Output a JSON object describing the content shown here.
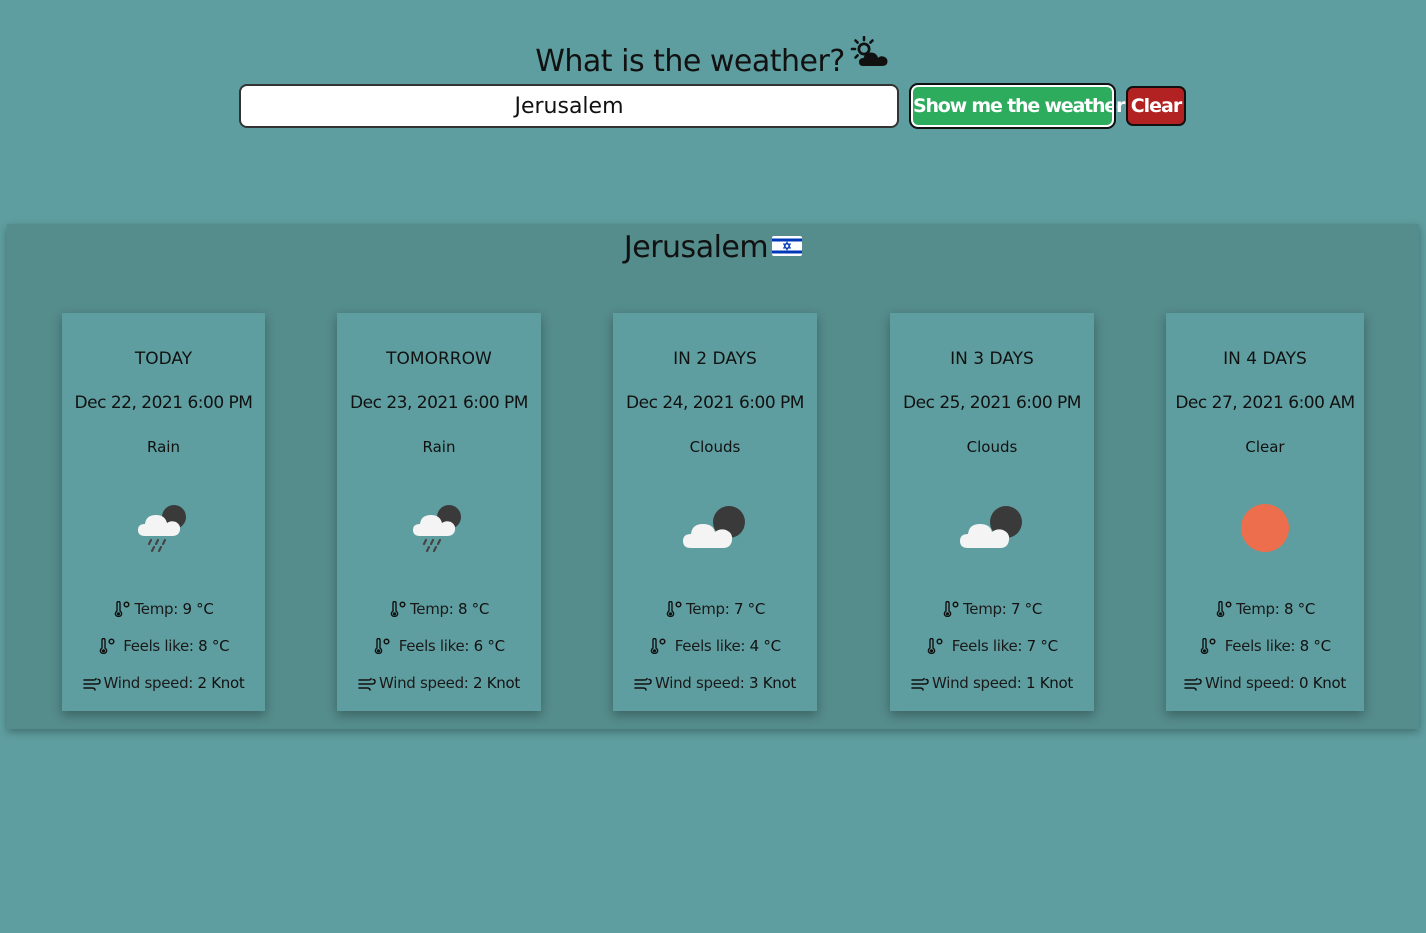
{
  "header": {
    "title": "What is the weather?",
    "title_icon": "sun-behind-cloud-icon"
  },
  "search": {
    "value": "Jerusalem",
    "show_label": "Show me the weather!",
    "clear_label": "Clear"
  },
  "results": {
    "city": "Jerusalem",
    "flag": "israel-flag-icon",
    "days": [
      {
        "day": "TODAY",
        "date": "Dec 22, 2021 6:00  PM",
        "condition": "Rain",
        "icon": "rain-cloud-icon",
        "temp_label": "Temp:",
        "temp": "9 °C",
        "feels_label": "Feels like:",
        "feels": "8 °C",
        "wind_label": "Wind speed:",
        "wind": "2  Knot"
      },
      {
        "day": "TOMORROW",
        "date": "Dec 23, 2021 6:00  PM",
        "condition": "Rain",
        "icon": "rain-cloud-icon",
        "temp_label": "Temp:",
        "temp": "8 °C",
        "feels_label": "Feels like:",
        "feels": "6 °C",
        "wind_label": "Wind speed:",
        "wind": "2  Knot"
      },
      {
        "day": "IN 2  DAYS",
        "date": "Dec 24, 2021 6:00  PM",
        "condition": "Clouds",
        "icon": "cloud-icon",
        "temp_label": "Temp:",
        "temp": "7 °C",
        "feels_label": "Feels like:",
        "feels": "4 °C",
        "wind_label": "Wind speed:",
        "wind": "3  Knot"
      },
      {
        "day": "IN 3  DAYS",
        "date": "Dec 25, 2021 6:00  PM",
        "condition": "Clouds",
        "icon": "cloud-icon",
        "temp_label": "Temp:",
        "temp": "7 °C",
        "feels_label": "Feels like:",
        "feels": "7 °C",
        "wind_label": "Wind speed:",
        "wind": "1  Knot"
      },
      {
        "day": "IN 4  DAYS",
        "date": "Dec 27, 2021 6:00 AM",
        "condition": "Clear",
        "icon": "sun-icon",
        "temp_label": "Temp:",
        "temp": "8 °C",
        "feels_label": "Feels like:",
        "feels": "8 °C",
        "wind_label": "Wind speed:",
        "wind": "0  Knot"
      }
    ]
  },
  "colors": {
    "background": "#5f9ea0",
    "panel": "#558c8c",
    "show_button": "#2eac5e",
    "clear_button": "#b22222",
    "sun": "#ec6e4c"
  }
}
